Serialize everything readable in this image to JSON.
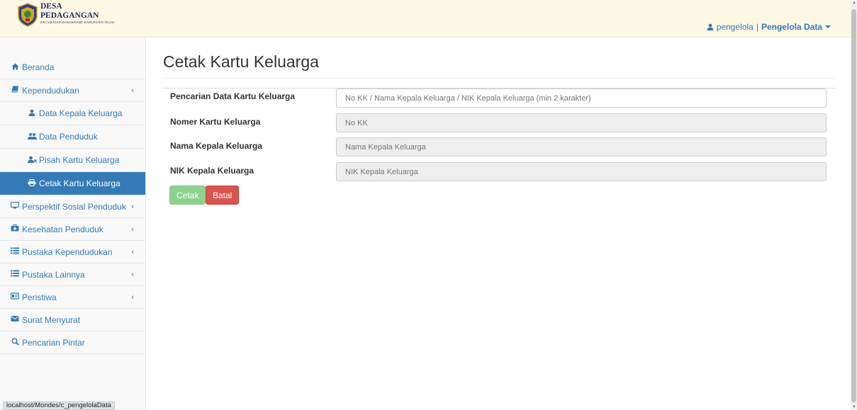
{
  "header": {
    "brand_line1": "DESA",
    "brand_line2": "PEDAGANGAN",
    "brand_line3": "KECAMATAN DUKUHWARU KABUPATEN TEGAL",
    "user_name": "pengelola",
    "separator": "|",
    "user_role": "Pengelola Data"
  },
  "sidebar": {
    "items": [
      {
        "label": "Beranda",
        "icon": "home-icon"
      },
      {
        "label": "Kependudukan",
        "icon": "book-icon",
        "has_children": true,
        "chevron": "‹"
      },
      {
        "label": "Data Kepala Keluarga",
        "icon": "user-icon"
      },
      {
        "label": "Data Penduduk",
        "icon": "users-icon"
      },
      {
        "label": "Pisah Kartu Keluarga",
        "icon": "user-times-icon"
      },
      {
        "label": "Cetak Kartu Keluarga",
        "icon": "print-icon",
        "active": true
      },
      {
        "label": "Perspektif Sosial Penduduk",
        "icon": "desktop-icon",
        "has_children": true,
        "chevron": "‹"
      },
      {
        "label": "Kesehatan Penduduk",
        "icon": "medkit-icon",
        "has_children": true,
        "chevron": "‹"
      },
      {
        "label": "Pustaka Kependudukan",
        "icon": "list-icon",
        "has_children": true,
        "chevron": "‹"
      },
      {
        "label": "Pustaka Lainnya",
        "icon": "list-icon",
        "has_children": true,
        "chevron": "‹"
      },
      {
        "label": "Peristiwa",
        "icon": "id-card-icon",
        "has_children": true,
        "chevron": "‹"
      },
      {
        "label": "Surat Menyurat",
        "icon": "envelope-icon"
      },
      {
        "label": "Pencarian Pintar",
        "icon": "search-icon"
      }
    ]
  },
  "main": {
    "title": "Cetak Kartu Keluarga",
    "form": {
      "search_label": "Pencarian Data Kartu Keluarga",
      "search_placeholder": "No KK / Nama Kepala Keluarga / NIK Kepala Keluarga (min 2 karakter)",
      "no_kk_label": "Nomer Kartu Keluarga",
      "no_kk_placeholder": "No KK",
      "nama_label": "Nama Kepala Keluarga",
      "nama_placeholder": "Nama Kepala Keluarga",
      "nik_label": "NIK Kepala Keluarga",
      "nik_placeholder": "NIK Kepala Keluarga"
    },
    "buttons": {
      "cetak": "Cetak",
      "batal": "Batal"
    }
  },
  "status_bar": {
    "url": "localhost/Mondes/c_pengelolaData"
  },
  "colors": {
    "link": "#337ab7",
    "active_bg": "#337ab7",
    "header_bg": "#fdf8e4",
    "btn_success_disabled": "#8ed18e",
    "btn_danger": "#d9534f"
  }
}
